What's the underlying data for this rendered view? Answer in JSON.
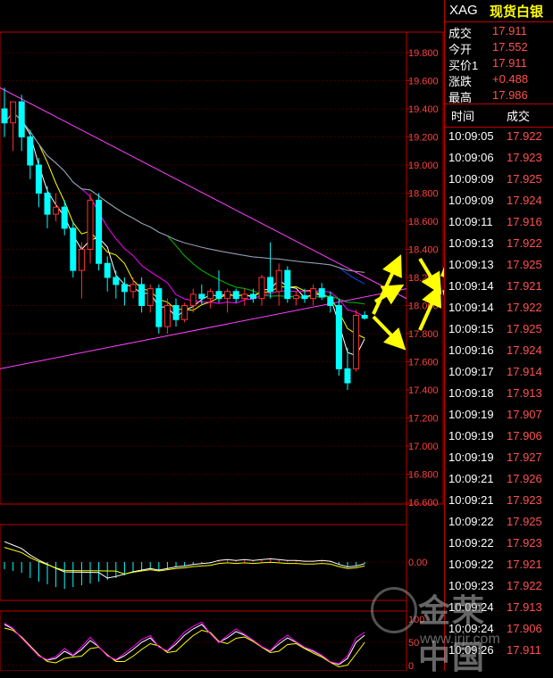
{
  "quote": {
    "code": "XAG",
    "name": "现货白银",
    "rows": [
      {
        "label": "成交",
        "value": "17.911"
      },
      {
        "label": "今开",
        "value": "17.552"
      },
      {
        "label": "买价1",
        "value": "17.911"
      },
      {
        "label": "涨跌",
        "value": "+0.488"
      },
      {
        "label": "最高",
        "value": "17.986"
      }
    ]
  },
  "trades": {
    "header_time": "时间",
    "header_price": "成交",
    "rows": [
      {
        "time": "10:09:05",
        "price": "17.922"
      },
      {
        "time": "10:09:06",
        "price": "17.923"
      },
      {
        "time": "10:09:09",
        "price": "17.925"
      },
      {
        "time": "10:09:09",
        "price": "17.924"
      },
      {
        "time": "10:09:11",
        "price": "17.916"
      },
      {
        "time": "10:09:13",
        "price": "17.922"
      },
      {
        "time": "10:09:13",
        "price": "17.925"
      },
      {
        "time": "10:09:14",
        "price": "17.921"
      },
      {
        "time": "10:09:14",
        "price": "17.922"
      },
      {
        "time": "10:09:15",
        "price": "17.925"
      },
      {
        "time": "10:09:16",
        "price": "17.924"
      },
      {
        "time": "10:09:17",
        "price": "17.914"
      },
      {
        "time": "10:09:18",
        "price": "17.913"
      },
      {
        "time": "10:09:19",
        "price": "17.907"
      },
      {
        "time": "10:09:19",
        "price": "17.906"
      },
      {
        "time": "10:09:19",
        "price": "17.927"
      },
      {
        "time": "10:09:21",
        "price": "17.926"
      },
      {
        "time": "10:09:21",
        "price": "17.923"
      },
      {
        "time": "10:09:22",
        "price": "17.925"
      },
      {
        "time": "10:09:22",
        "price": "17.923"
      },
      {
        "time": "10:09:22",
        "price": "17.921"
      },
      {
        "time": "10:09:23",
        "price": "17.922"
      },
      {
        "time": "10:09:24",
        "price": "17.913"
      },
      {
        "time": "10:09:24",
        "price": "17.906"
      },
      {
        "time": "10:09:26",
        "price": "17.911"
      }
    ]
  },
  "watermark": {
    "brand": "金荣中国",
    "url": "www.jrjr.com"
  },
  "colors": {
    "up": "#ff3030",
    "down": "#00ffff",
    "ma1": "#ffffff",
    "ma2": "#ffff00",
    "ma3": "#ff00ff",
    "ma4": "#00c000",
    "ma5": "#0050ff",
    "ma6": "#a0a0a0",
    "trendline": "#ff40ff",
    "arrow": "#ffff00"
  },
  "chart_data": {
    "type": "candlestick",
    "ylim": [
      16.6,
      19.9
    ],
    "yticks": [
      "19.800",
      "19.600",
      "19.400",
      "19.200",
      "19.000",
      "18.800",
      "18.600",
      "18.400",
      "18.200",
      "18.000",
      "17.800",
      "17.600",
      "17.400",
      "17.200",
      "17.000",
      "16.800",
      "16.600"
    ],
    "candles": [
      {
        "o": 19.4,
        "h": 19.55,
        "l": 19.2,
        "c": 19.3
      },
      {
        "o": 19.3,
        "h": 19.45,
        "l": 19.1,
        "c": 19.45
      },
      {
        "o": 19.45,
        "h": 19.5,
        "l": 19.1,
        "c": 19.2
      },
      {
        "o": 19.2,
        "h": 19.25,
        "l": 18.9,
        "c": 19.0
      },
      {
        "o": 19.0,
        "h": 19.05,
        "l": 18.7,
        "c": 18.8
      },
      {
        "o": 18.8,
        "h": 18.85,
        "l": 18.55,
        "c": 18.65
      },
      {
        "o": 18.65,
        "h": 18.8,
        "l": 18.6,
        "c": 18.7
      },
      {
        "o": 18.7,
        "h": 18.75,
        "l": 18.5,
        "c": 18.55
      },
      {
        "o": 18.55,
        "h": 18.6,
        "l": 18.2,
        "c": 18.25
      },
      {
        "o": 18.25,
        "h": 18.45,
        "l": 18.05,
        "c": 18.4
      },
      {
        "o": 18.4,
        "h": 18.8,
        "l": 18.3,
        "c": 18.75
      },
      {
        "o": 18.75,
        "h": 18.8,
        "l": 18.25,
        "c": 18.3
      },
      {
        "o": 18.3,
        "h": 18.35,
        "l": 18.1,
        "c": 18.2
      },
      {
        "o": 18.2,
        "h": 18.25,
        "l": 18.05,
        "c": 18.15
      },
      {
        "o": 18.15,
        "h": 18.2,
        "l": 18.0,
        "c": 18.1
      },
      {
        "o": 18.1,
        "h": 18.2,
        "l": 18.05,
        "c": 18.15
      },
      {
        "o": 18.15,
        "h": 18.2,
        "l": 17.95,
        "c": 18.0
      },
      {
        "o": 18.0,
        "h": 18.15,
        "l": 17.95,
        "c": 18.12
      },
      {
        "o": 18.12,
        "h": 18.15,
        "l": 17.8,
        "c": 17.85
      },
      {
        "o": 17.85,
        "h": 18.05,
        "l": 17.8,
        "c": 18.0
      },
      {
        "o": 18.0,
        "h": 18.05,
        "l": 17.85,
        "c": 17.9
      },
      {
        "o": 17.9,
        "h": 18.02,
        "l": 17.88,
        "c": 18.0
      },
      {
        "o": 18.0,
        "h": 18.12,
        "l": 17.95,
        "c": 18.08
      },
      {
        "o": 18.08,
        "h": 18.15,
        "l": 18.0,
        "c": 18.05
      },
      {
        "o": 18.05,
        "h": 18.12,
        "l": 17.98,
        "c": 18.1
      },
      {
        "o": 18.1,
        "h": 18.25,
        "l": 18.02,
        "c": 18.05
      },
      {
        "o": 18.05,
        "h": 18.12,
        "l": 17.95,
        "c": 18.1
      },
      {
        "o": 18.1,
        "h": 18.12,
        "l": 18.02,
        "c": 18.05
      },
      {
        "o": 18.05,
        "h": 18.12,
        "l": 18.0,
        "c": 18.08
      },
      {
        "o": 18.08,
        "h": 18.12,
        "l": 18.02,
        "c": 18.05
      },
      {
        "o": 18.05,
        "h": 18.22,
        "l": 18.0,
        "c": 18.2
      },
      {
        "o": 18.2,
        "h": 18.45,
        "l": 18.05,
        "c": 18.1
      },
      {
        "o": 18.1,
        "h": 18.3,
        "l": 18.0,
        "c": 18.25
      },
      {
        "o": 18.25,
        "h": 18.28,
        "l": 18.02,
        "c": 18.05
      },
      {
        "o": 18.05,
        "h": 18.1,
        "l": 18.0,
        "c": 18.07
      },
      {
        "o": 18.07,
        "h": 18.12,
        "l": 18.02,
        "c": 18.05
      },
      {
        "o": 18.05,
        "h": 18.15,
        "l": 18.0,
        "c": 18.12
      },
      {
        "o": 18.12,
        "h": 18.16,
        "l": 18.04,
        "c": 18.06
      },
      {
        "o": 18.06,
        "h": 18.1,
        "l": 17.95,
        "c": 18.0
      },
      {
        "o": 18.0,
        "h": 18.05,
        "l": 17.5,
        "c": 17.55
      },
      {
        "o": 17.55,
        "h": 17.7,
        "l": 17.4,
        "c": 17.45
      },
      {
        "o": 17.55,
        "h": 17.97,
        "l": 17.53,
        "c": 17.93
      },
      {
        "o": 17.93,
        "h": 17.96,
        "l": 17.9,
        "c": 17.91
      }
    ]
  }
}
